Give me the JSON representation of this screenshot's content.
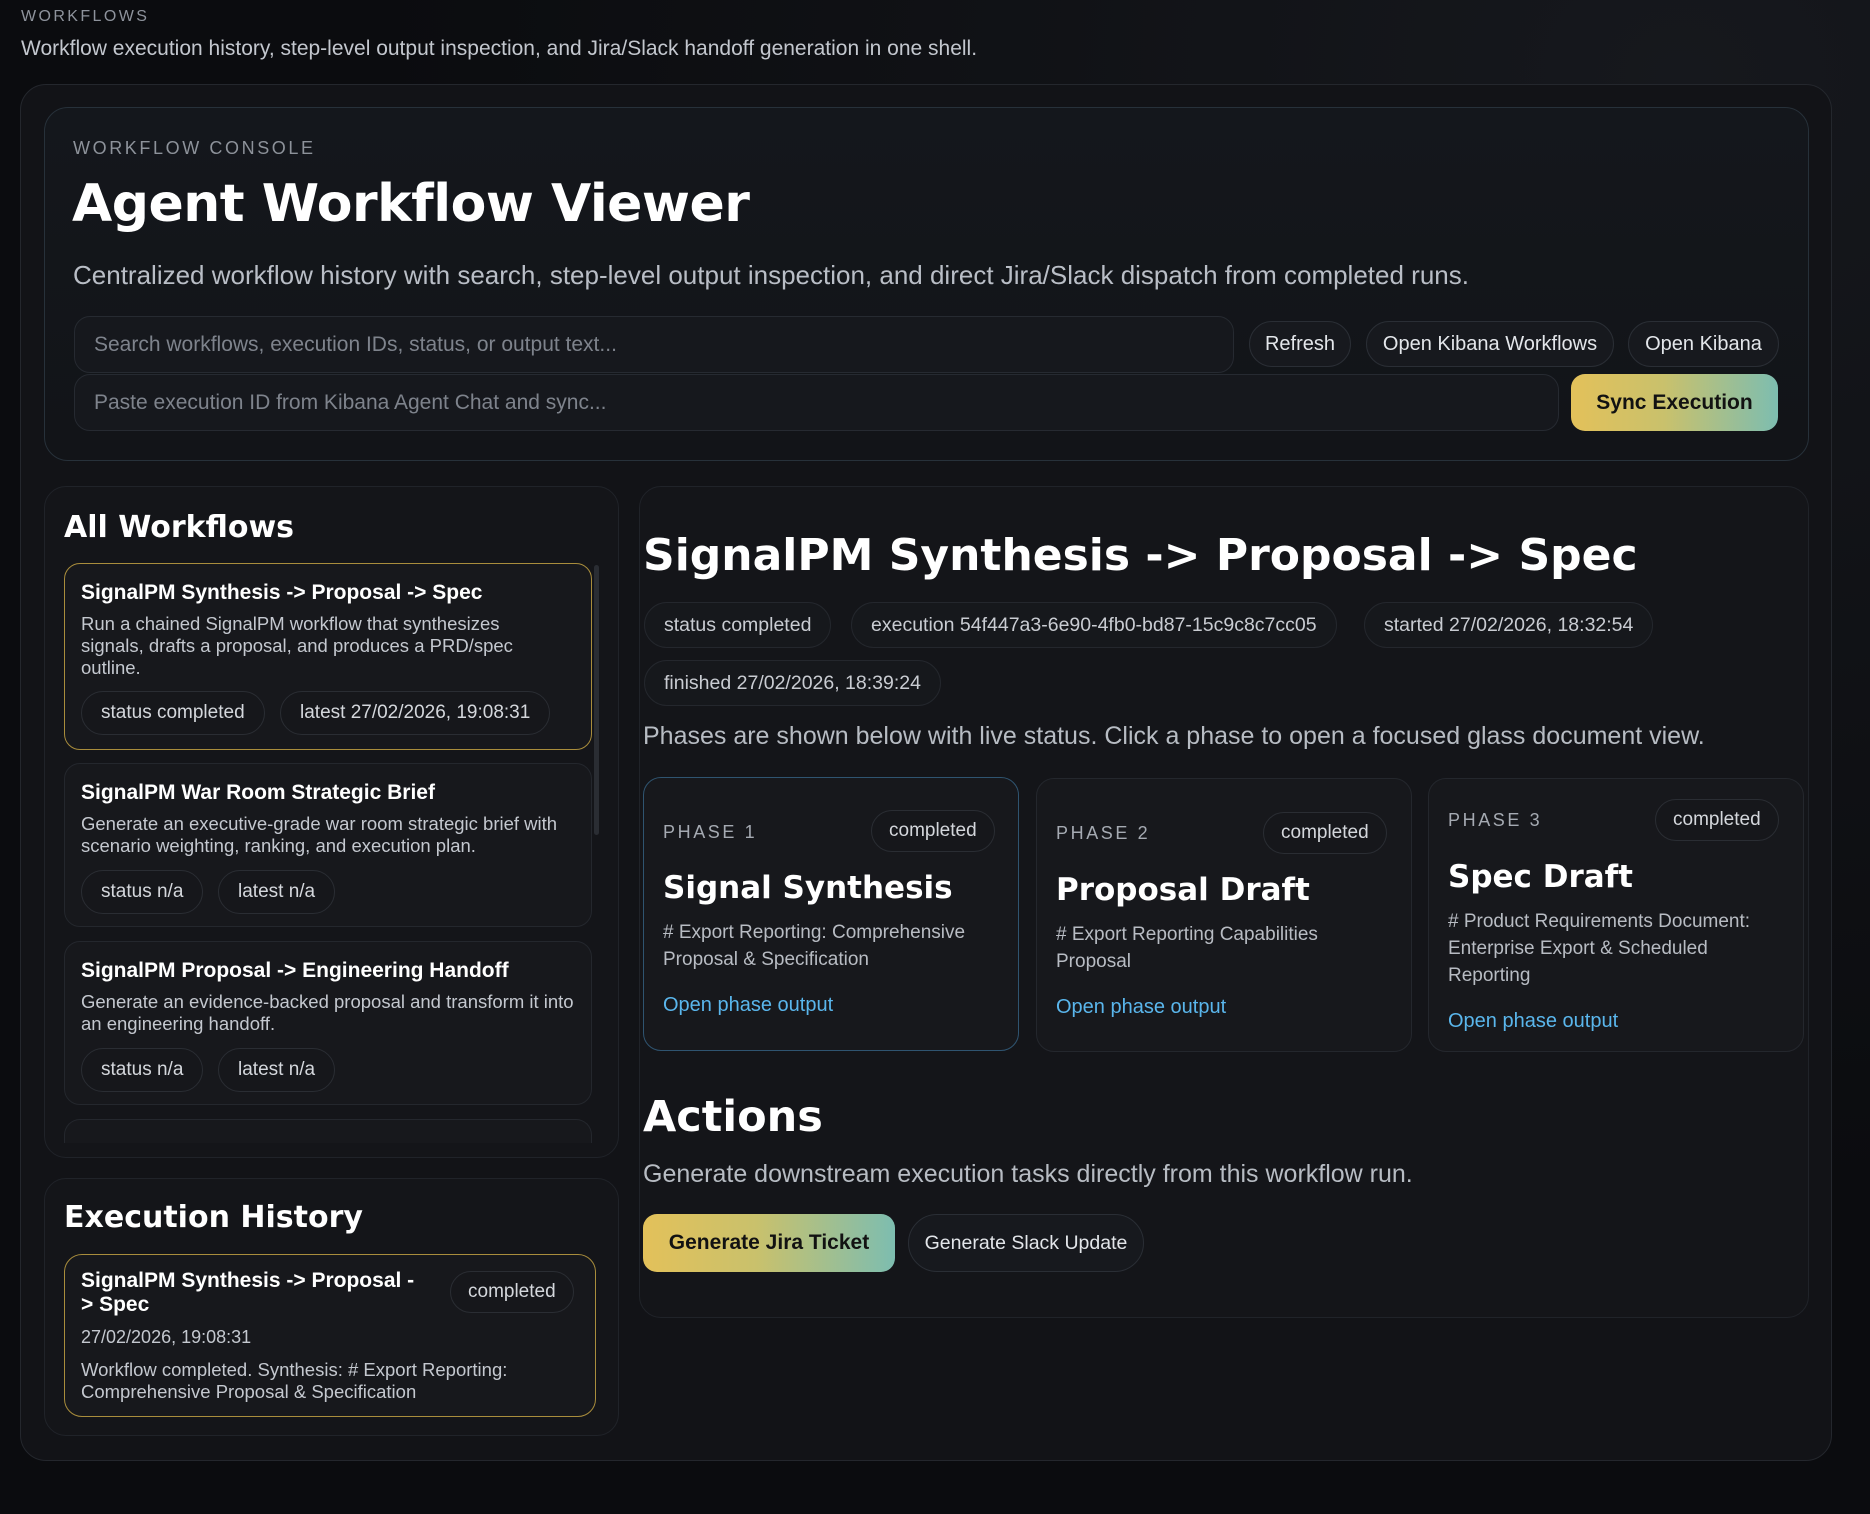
{
  "header": {
    "label": "WORKFLOWS",
    "description": "Workflow execution history, step-level output inspection, and Jira/Slack handoff generation in one shell."
  },
  "console": {
    "label": "WORKFLOW CONSOLE",
    "title": "Agent Workflow Viewer",
    "description": "Centralized workflow history with search, step-level output inspection, and direct Jira/Slack dispatch from completed runs.",
    "search_placeholder": "Search workflows, execution IDs, status, or output text...",
    "sync_placeholder": "Paste execution ID from Kibana Agent Chat and sync...",
    "refresh_label": "Refresh",
    "open_kibana_workflows_label": "Open Kibana Workflows",
    "open_kibana_label": "Open Kibana",
    "sync_label": "Sync Execution"
  },
  "workflows": {
    "title": "All Workflows",
    "items": [
      {
        "name": "SignalPM Synthesis -> Proposal -> Spec",
        "description": "Run a chained SignalPM workflow that synthesizes signals, drafts a proposal, and produces a PRD/spec outline.",
        "status": "status completed",
        "latest": "latest 27/02/2026, 19:08:31"
      },
      {
        "name": "SignalPM War Room Strategic Brief",
        "description": "Generate an executive-grade war room strategic brief with scenario weighting, ranking, and execution plan.",
        "status": "status n/a",
        "latest": "latest n/a"
      },
      {
        "name": "SignalPM Proposal -> Engineering Handoff",
        "description": "Generate an evidence-backed proposal and transform it into an engineering handoff.",
        "status": "status n/a",
        "latest": "latest n/a"
      }
    ]
  },
  "history": {
    "title": "Execution History",
    "items": [
      {
        "name": "SignalPM Synthesis -> Proposal -> Spec",
        "badge": "completed",
        "timestamp": "27/02/2026, 19:08:31",
        "summary": "Workflow completed. Synthesis: # Export Reporting: Comprehensive Proposal & Specification"
      }
    ]
  },
  "detail": {
    "title": "SignalPM Synthesis -> Proposal -> Spec",
    "status": "status completed",
    "execution": "execution 54f447a3-6e90-4fb0-bd87-15c9c8c7cc05",
    "started": "started 27/02/2026, 18:32:54",
    "finished": "finished 27/02/2026, 18:39:24",
    "description": "Phases are shown below with live status. Click a phase to open a focused glass document view.",
    "phases": [
      {
        "label": "PHASE 1",
        "badge": "completed",
        "title": "Signal Synthesis",
        "body": "# Export Reporting: Comprehensive Proposal & Specification",
        "link": "Open phase output"
      },
      {
        "label": "PHASE 2",
        "badge": "completed",
        "title": "Proposal Draft",
        "body": "# Export Reporting Capabilities Proposal",
        "link": "Open phase output"
      },
      {
        "label": "PHASE 3",
        "badge": "completed",
        "title": "Spec Draft",
        "body": "# Product Requirements Document: Enterprise Export & Scheduled Reporting",
        "link": "Open phase output"
      }
    ]
  },
  "actions": {
    "title": "Actions",
    "description": "Generate downstream execution tasks directly from this workflow run.",
    "jira_label": "Generate Jira Ticket",
    "slack_label": "Generate Slack Update"
  },
  "colors": {
    "background": "#0b0c0f",
    "accent_gold": "#e3c15a",
    "accent_teal": "#7dbdb0",
    "link_blue": "#5ab6ec",
    "active_border": "#a98d3c"
  }
}
